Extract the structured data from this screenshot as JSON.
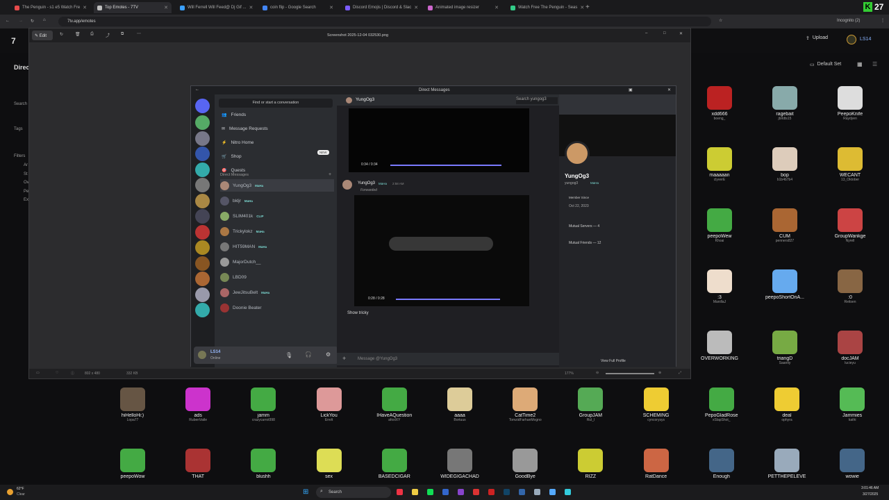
{
  "browser": {
    "tabs": [
      {
        "label": "The Penguin - s1 e5 Watch Fre",
        "color": "#e64b4b"
      },
      {
        "label": "Top Emotes - 7TV",
        "color": "#bfbfbf",
        "active": true
      },
      {
        "label": "Will Ferrell Will Feed@ Dj Gif ...",
        "color": "#3aa0ff"
      },
      {
        "label": "coin flip - Google Search",
        "color": "#4285f4"
      },
      {
        "label": "Discord Emojis | Discord & Slac",
        "color": "#7b5cff"
      },
      {
        "label": "Animated image resizer",
        "color": "#cc66cc"
      },
      {
        "label": "Watch Free The Penguin - Seas",
        "color": "#33cc88"
      }
    ],
    "new_tab": "+",
    "url": "7tv.app/emotes",
    "incognito": "Incognito (2)",
    "ext_badge": "27"
  },
  "site": {
    "upload": "Upload",
    "user": "LS14",
    "default_set": "Default Set",
    "sidebar": {
      "title": "Direc",
      "search": "Search",
      "tags": "Tags",
      "filters": "Filters",
      "filter_items": [
        "Ar",
        "St",
        "Ov",
        "Pe",
        "Ex"
      ]
    }
  },
  "viewer": {
    "edit": "Edit",
    "filename": "Screenshot 2025-12-04 032530.png",
    "dims": "802 x 480",
    "size": "332 KB",
    "zoom": "177%"
  },
  "discord": {
    "title": "Direct Messages",
    "search_conv": "Find or start a conversation",
    "header_user": "YungOg3",
    "search_placeholder": "Search yungog3",
    "nav": [
      "Friends",
      "Message Requests",
      "Nitro Home",
      "Shop",
      "Quests"
    ],
    "new_badge": "NEW",
    "dm_header": "Direct Messages",
    "dms": [
      {
        "name": "YungOg3",
        "tag": "MaHa"
      },
      {
        "name": "bkljr",
        "tag": "MaHa"
      },
      {
        "name": "SLIM401k",
        "tag": "CLIP"
      },
      {
        "name": "Trickylokz",
        "tag": "MaHa"
      },
      {
        "name": "HIT59MAN",
        "tag": "MaHa"
      },
      {
        "name": "MajorDutch__",
        "tag": ""
      },
      {
        "name": "LBD09",
        "tag": ""
      },
      {
        "name": "JewJitsuBelt",
        "tag": "MaHa"
      },
      {
        "name": "Doonie Beater",
        "tag": ""
      }
    ],
    "me": {
      "name": "LS14",
      "status": "Online"
    },
    "video1_time": "0:34 / 0:34",
    "video2_time": "0:28 / 0:28",
    "msg_author": "YungOg3",
    "msg_tag": "MaHa",
    "msg_time": "2:58 AM",
    "forwarded": "Forwarded",
    "show_text": "Show tricky",
    "input_placeholder": "Message @YungOg3",
    "profile": {
      "name": "YungOg3",
      "handle": "yungog3",
      "tag": "MaHa",
      "member_since_label": "Member Since",
      "member_since": "Oct 22, 2023",
      "mutual_servers": "Mutual Servers — 4",
      "mutual_friends": "Mutual Friends — 12",
      "view_full": "View Full Profile"
    }
  },
  "emotes_right": [
    {
      "name": "xdd666",
      "author": "boeng_",
      "color": "#b22"
    },
    {
      "name": "ragebait",
      "author": "jbrldts15",
      "color": "#8aa"
    },
    {
      "name": "PeepoKnife",
      "author": "Raydyen",
      "color": "#ddd"
    },
    {
      "name": "maaaaan",
      "author": "clyverE",
      "color": "#cc3"
    },
    {
      "name": "bop",
      "author": "b1b4b7b4",
      "color": "#dcb"
    },
    {
      "name": "WECANT",
      "author": "13_Oktober",
      "color": "#db3"
    },
    {
      "name": "peepoWew",
      "author": "Khoai",
      "color": "#4a4"
    },
    {
      "name": "CUM",
      "author": "penners827",
      "color": "#a63"
    },
    {
      "name": "GroupWankge",
      "author": "Nyrell",
      "color": "#c44"
    },
    {
      "name": ":3",
      "author": "ManillaJ",
      "color": "#edc"
    },
    {
      "name": "peepoShortOnA...",
      "author": "",
      "color": "#6ae"
    },
    {
      "name": ":0",
      "author": "Reitsen",
      "color": "#864"
    },
    {
      "name": "OVERWORKING",
      "author": "",
      "color": "#bbb"
    },
    {
      "name": "triangD",
      "author": "Saanity",
      "color": "#7a4"
    },
    {
      "name": "docJAM",
      "author": "lucieyu",
      "color": "#a44"
    }
  ],
  "emotes_bottom": [
    {
      "name": "hiHelloHi:)",
      "author": "Lopa77",
      "color": "#654"
    },
    {
      "name": "ads",
      "author": "RubenVatle",
      "color": "#c3c"
    },
    {
      "name": "jamm",
      "author": "crazycarrot998",
      "color": "#4a4"
    },
    {
      "name": "LickYou",
      "author": "Envtt",
      "color": "#d99"
    },
    {
      "name": "IHaveAQuestion",
      "author": "afoxiXY",
      "color": "#4a4"
    },
    {
      "name": "aaaa",
      "author": "Bortuus",
      "color": "#dc9"
    },
    {
      "name": "CatTime2",
      "author": "TomzidFarhanMogno",
      "color": "#da7"
    },
    {
      "name": "GroupJAM",
      "author": "Rul_l",
      "color": "#5a5"
    },
    {
      "name": "SCHEMING",
      "author": "cyncorysys",
      "color": "#ec3"
    },
    {
      "name": "PepoGladRose",
      "author": "xSlapShot_",
      "color": "#4a4"
    },
    {
      "name": "deal",
      "author": "ophyra",
      "color": "#ec3"
    },
    {
      "name": "Jammies",
      "author": "kathi",
      "color": "#5b5"
    }
  ],
  "emotes_row3": [
    {
      "name": "peepoWow",
      "color": "#4a4"
    },
    {
      "name": "THAT",
      "color": "#a33"
    },
    {
      "name": "blushh",
      "color": "#4a4"
    },
    {
      "name": "sex",
      "color": "#dd5"
    },
    {
      "name": "BASEDCIGAR",
      "color": "#4a4"
    },
    {
      "name": "WIDEGIGACHAD",
      "color": "#777"
    },
    {
      "name": "GoodBye",
      "color": "#999"
    },
    {
      "name": "RIZZ",
      "color": "#cc3"
    },
    {
      "name": "RatDance",
      "color": "#c64"
    },
    {
      "name": "Enough",
      "color": "#468"
    },
    {
      "name": "PETTHEPELEVE",
      "color": "#9ab"
    },
    {
      "name": "wowie",
      "color": "#468"
    }
  ],
  "taskbar": {
    "weather_temp": "62°F",
    "weather_desc": "Clear",
    "search": "Search",
    "time": "3:01:46 AM",
    "date": "3/27/2025"
  }
}
